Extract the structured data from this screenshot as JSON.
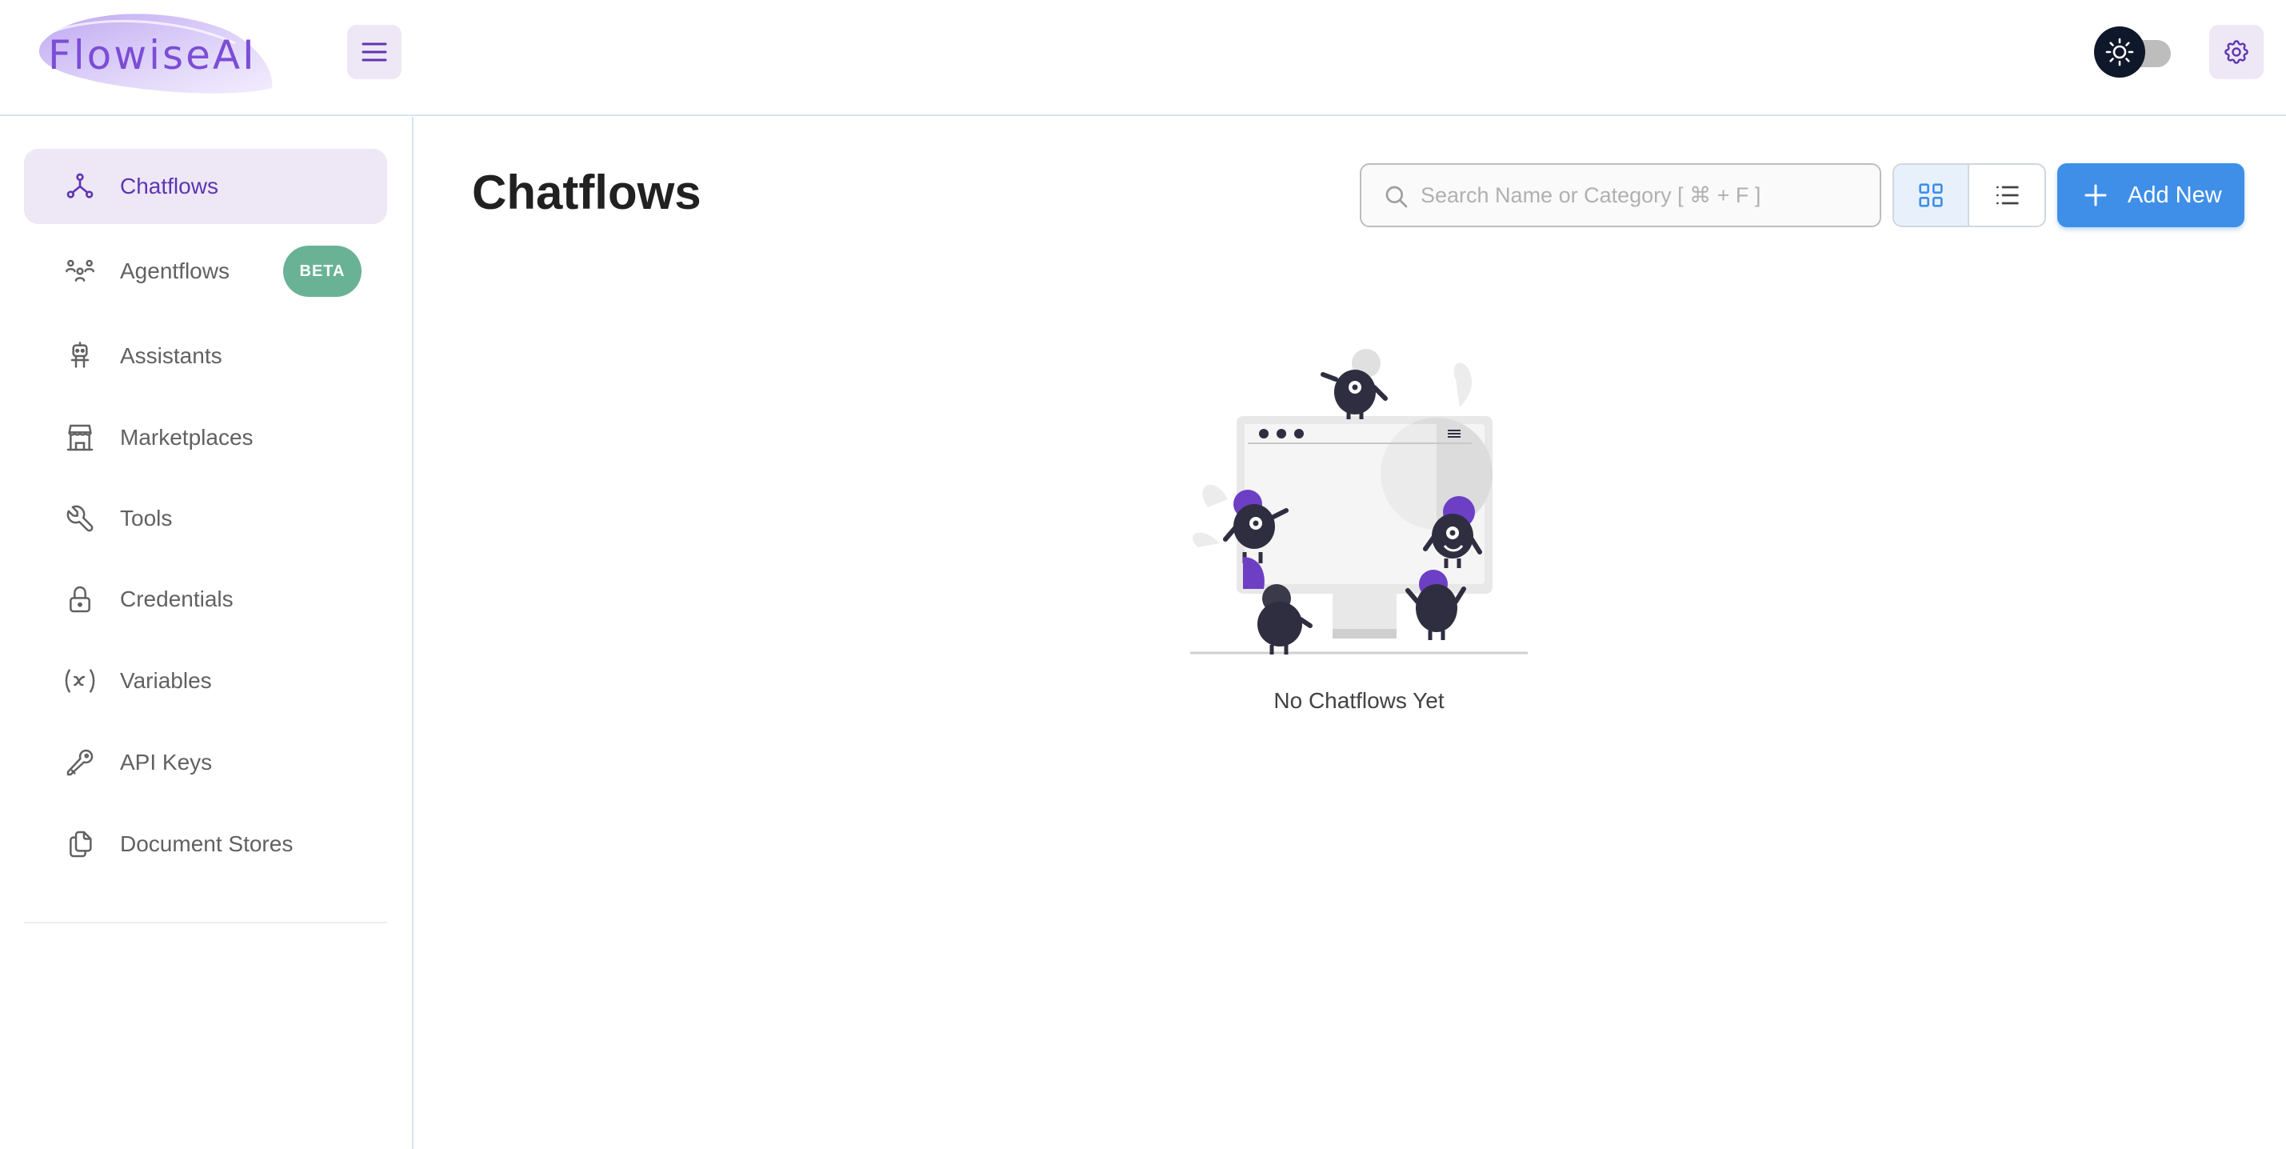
{
  "app": {
    "logo_text": "FlowiseAI",
    "accent_color": "#7c4dd6",
    "primary_button_color": "#3f8fe8"
  },
  "header": {
    "menu_icon": "hamburger-icon",
    "theme_toggle_icon": "sun-icon",
    "theme_toggle_state": "off",
    "settings_icon": "gear-icon"
  },
  "sidebar": {
    "items": [
      {
        "label": "Chatflows",
        "icon": "chatflow-icon",
        "active": true
      },
      {
        "label": "Agentflows",
        "icon": "users-group-icon",
        "badge": "BETA"
      },
      {
        "label": "Assistants",
        "icon": "robot-icon"
      },
      {
        "label": "Marketplaces",
        "icon": "store-icon"
      },
      {
        "label": "Tools",
        "icon": "wrench-icon"
      },
      {
        "label": "Credentials",
        "icon": "lock-icon"
      },
      {
        "label": "Variables",
        "icon": "variable-icon"
      },
      {
        "label": "API Keys",
        "icon": "key-icon"
      },
      {
        "label": "Document Stores",
        "icon": "files-icon"
      }
    ]
  },
  "main": {
    "title": "Chatflows",
    "search": {
      "placeholder": "Search Name or Category [ ⌘ + F ]",
      "value": ""
    },
    "view_mode": "card",
    "add_button_label": "Add New",
    "empty_state_text": "No Chatflows Yet"
  }
}
